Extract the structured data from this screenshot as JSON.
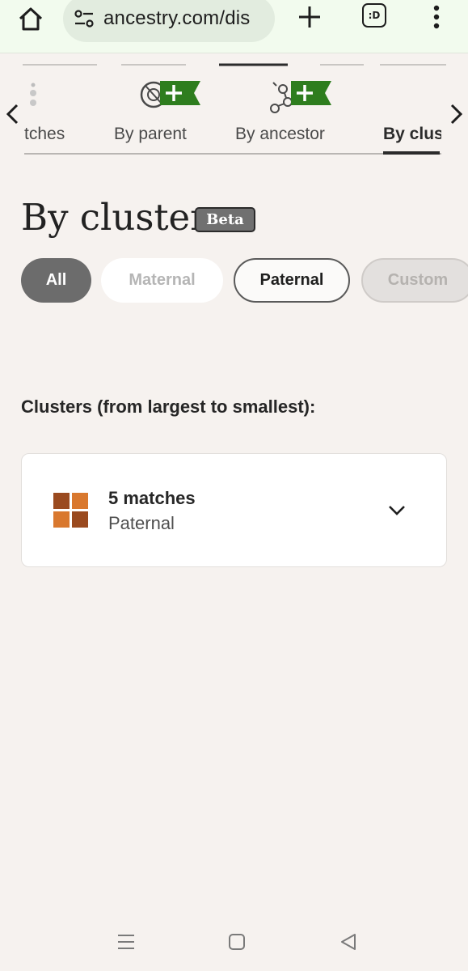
{
  "browser": {
    "url": "ancestry.com/dis",
    "tabs_label": ":D"
  },
  "carousel": {
    "items": [
      {
        "label": "tches",
        "icon": "dots-icon"
      },
      {
        "label": "By parent",
        "icon": "parent-add-icon"
      },
      {
        "label": "By ancestor",
        "icon": "ancestor-add-icon"
      },
      {
        "label": "By clus",
        "icon": null,
        "active": true
      }
    ]
  },
  "page": {
    "title": "By cluster",
    "badge": "Beta"
  },
  "filters": [
    {
      "label": "All",
      "state": "selected"
    },
    {
      "label": "Maternal",
      "state": "disabled"
    },
    {
      "label": "Paternal",
      "state": "outlined"
    },
    {
      "label": "Custom",
      "state": "disabled"
    }
  ],
  "clusters": {
    "heading": "Clusters (from largest to smallest):",
    "items": [
      {
        "count": "5 matches",
        "side": "Paternal"
      }
    ]
  },
  "colors": {
    "browser_bg": "#f2fbee",
    "page_bg": "#f6f2ef",
    "accent_green": "#2e7d1e",
    "cluster_orange_dark": "#9a4a1f",
    "cluster_orange_light": "#d9782e"
  }
}
